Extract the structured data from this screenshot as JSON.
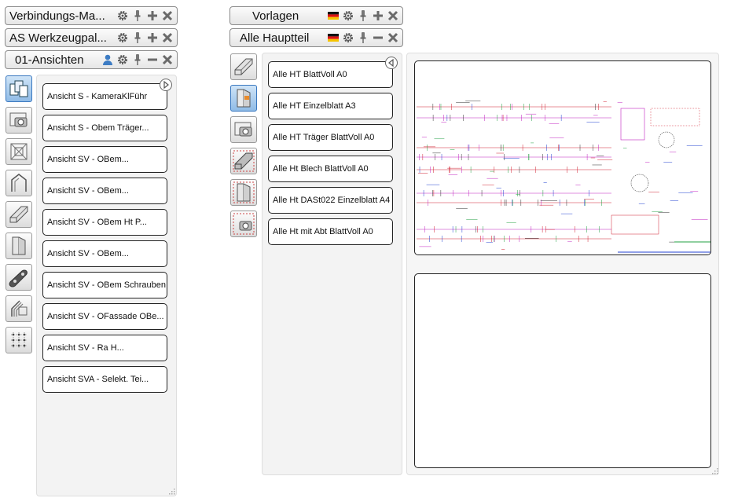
{
  "left_headers": [
    {
      "title": "Verbindungs-Ma...",
      "icons": [
        "gear-icon",
        "pin-icon",
        "plus-icon",
        "close-icon"
      ]
    },
    {
      "title": "AS Werkzeugpal...",
      "icons": [
        "gear-icon",
        "pin-icon",
        "plus-icon",
        "close-icon"
      ]
    },
    {
      "title": "01-Ansichten",
      "icons": [
        "user-icon",
        "gear-icon",
        "pin-icon",
        "minus-icon",
        "close-icon"
      ]
    }
  ],
  "right_headers": [
    {
      "title": "Vorlagen",
      "icons": [
        "flag-de-icon",
        "gear-icon",
        "pin-icon",
        "plus-icon",
        "close-icon"
      ]
    },
    {
      "title": "Alle Hauptteil",
      "icons": [
        "flag-de-icon",
        "gear-icon",
        "pin-icon",
        "minus-icon",
        "close-icon"
      ]
    }
  ],
  "views_list": [
    "Ansicht S - KameraKlFühr",
    "Ansicht S - Obem Träger...",
    "Ansicht SV - OBem...",
    "Ansicht SV - OBem...",
    "Ansicht SV - OBem Ht P...",
    "Ansicht SV - OBem...",
    "Ansicht SV - OBem Schrauben",
    "Ansicht SV - OFassade OBe...",
    "Ansicht SV - Ra H...",
    "Ansicht SVA - Selekt. Tei..."
  ],
  "template_list": [
    "Alle HT BlattVoll A0",
    "Alle HT Einzelblatt A3",
    "Alle HT Träger BlattVoll A0",
    "Alle Ht Blech BlattVoll A0",
    "Alle Ht DASt022 Einzelblatt A4",
    "Alle Ht mit Abt BlattVoll A0"
  ],
  "left_tiles": [
    "views-3d-icon",
    "camera-icon",
    "frame-corners-icon",
    "profile-angle-icon",
    "beam-icon",
    "column-icon",
    "plate-icon",
    "connection-icon",
    "grid-icon"
  ],
  "right_tiles": [
    "beam-icon",
    "column-section-icon",
    "camera-icon",
    "beam-dashed-icon",
    "column-dashed-icon",
    "camera-dashed-icon"
  ],
  "colors": {
    "accent": "#3a78c0",
    "drawing_red": "#d02030",
    "drawing_magenta": "#c020c0",
    "drawing_green": "#20a040",
    "drawing_blue": "#2040d0"
  }
}
